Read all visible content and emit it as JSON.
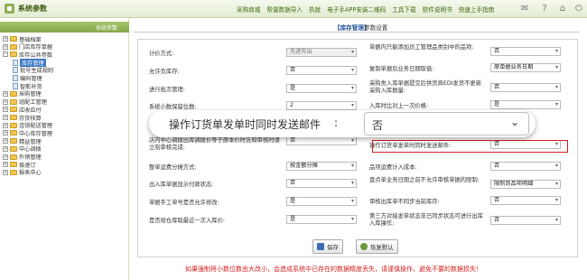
{
  "app": {
    "title": "系统参数"
  },
  "topnav": [
    "采购商城",
    "帮量数据导入",
    "执就",
    "电子手APP安装二维码",
    "工具下载",
    "软件说明书",
    "快速上手指南"
  ],
  "sidebar": {
    "title": "系统参数",
    "items": [
      {
        "label": "基础档案",
        "level": 0,
        "type": "plus"
      },
      {
        "label": "门店库存单据",
        "level": 0,
        "type": "plus"
      },
      {
        "label": "库存公共参数",
        "level": 0,
        "type": "minus"
      },
      {
        "label": "库存管理",
        "level": 1,
        "type": "page",
        "selected": true
      },
      {
        "label": "批号生成规则",
        "level": 1,
        "type": "page"
      },
      {
        "label": "编码管理",
        "level": 1,
        "type": "page"
      },
      {
        "label": "智能补货",
        "level": 1,
        "type": "page"
      },
      {
        "label": "采购管理",
        "level": 0,
        "type": "plus"
      },
      {
        "label": "组配工管理",
        "level": 0,
        "type": "plus"
      },
      {
        "label": "应收应付",
        "level": 0,
        "type": "plus"
      },
      {
        "label": "存货核算",
        "level": 0,
        "type": "plus"
      },
      {
        "label": "连锁配送管理",
        "level": 0,
        "type": "plus"
      },
      {
        "label": "中心库存管理",
        "level": 0,
        "type": "plus"
      },
      {
        "label": "精益管理",
        "level": 0,
        "type": "plus"
      },
      {
        "label": "中心调拨",
        "level": 0,
        "type": "plus"
      },
      {
        "label": "外销管理",
        "level": 0,
        "type": "plus"
      },
      {
        "label": "极速订",
        "level": 0,
        "type": "plus"
      },
      {
        "label": "报表中心",
        "level": 0,
        "type": "plus"
      }
    ]
  },
  "tab": {
    "active": "【库存管理】",
    "suffix": "参数设置"
  },
  "left_rows": [
    {
      "label": "计价方式:",
      "value": "先进先出",
      "disabled": true
    },
    {
      "label": "允许负库存:",
      "value": "否",
      "disabled": false
    },
    {
      "label": "进行批次管理:",
      "value": "是",
      "disabled": false
    },
    {
      "label": "系统小数保留位数:",
      "value": "2",
      "disabled": false
    },
    {
      "label": "店内中心调拨出库调拨价等于原本价时告知审核时请立刻审核完成:",
      "value": "否",
      "disabled": false
    },
    {
      "label": "整单运费分摊方式:",
      "value": "按金额分摊",
      "disabled": false
    },
    {
      "label": "出入库单据显示付款状态:",
      "value": "否",
      "disabled": false
    },
    {
      "label": "单据手工单号是否允许修改:",
      "value": "是",
      "disabled": false
    },
    {
      "label": "是否按仓库取最近一次入库价:",
      "value": "是",
      "disabled": false
    }
  ],
  "right_rows": [
    {
      "label": "单据内只能添加员工管理品类别中的品项:",
      "value": "否"
    },
    {
      "label": "复制单据后业务日期取值:",
      "value": "原单据业务日期"
    },
    {
      "label": "采购类入库单据提交后供货商EDI发货不更新采购入库数量:",
      "value": "否"
    },
    {
      "label": "入库时比对上一次价格:",
      "value": "是"
    },
    {
      "label": "操作订货单发单时同时发送邮件:",
      "value": "否"
    },
    {
      "label": "品项运费计入成本:",
      "value": "否"
    },
    {
      "label": "盘点单业务日期之前不允许审核单据的限制:",
      "value": "限制到品项明细"
    },
    {
      "label": "审核出库单不同步当前库存:",
      "value": "否"
    },
    {
      "label": "第三方对接发单状态非已同步状态可进行出库入库操作:",
      "value": "否"
    }
  ],
  "overlay": {
    "label": "操作订货单发单时同时发送邮件",
    "colon": ":",
    "value": "否"
  },
  "buttons": {
    "save": "保存",
    "restore": "恢复默认"
  },
  "warning": "如果强制将小数位数由大改小，会造成系统中已存在的数据精度丢失，请谨慎操作，避免不要的数据损失！",
  "icons": {
    "mail": "mail-icon",
    "help": "help-icon",
    "home": "home-icon",
    "power": "power-icon"
  }
}
